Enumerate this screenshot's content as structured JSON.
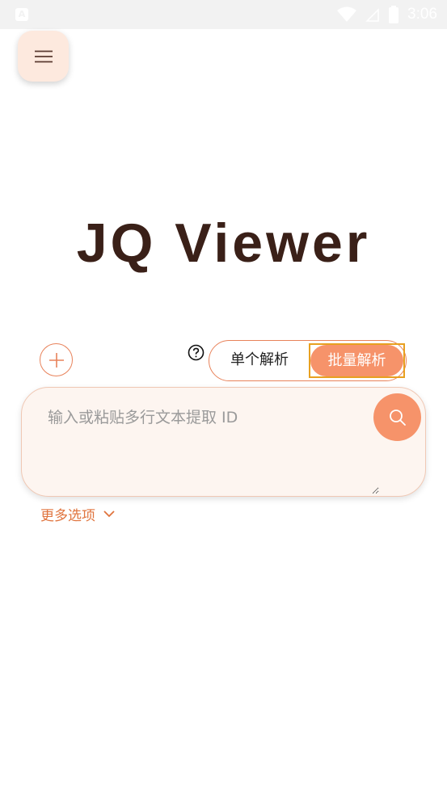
{
  "status_bar": {
    "time": "3:06",
    "left_icon": "a-notification-icon",
    "icons": [
      "wifi-icon",
      "signal-icon",
      "battery-icon"
    ]
  },
  "app": {
    "title": "JQ Viewer",
    "menu_icon": "hamburger-icon"
  },
  "mode_toggle": {
    "single_label": "单个解析",
    "batch_label": "批量解析",
    "selected": "batch"
  },
  "input": {
    "placeholder": "输入或粘贴多行文本提取 ID",
    "value": ""
  },
  "more_options": {
    "label": "更多选项"
  },
  "colors": {
    "accent": "#f6936a",
    "accent_border": "#e8825a",
    "title": "#3a2018",
    "card_bg": "#fdf5f0",
    "menu_bg": "#fde9de"
  }
}
